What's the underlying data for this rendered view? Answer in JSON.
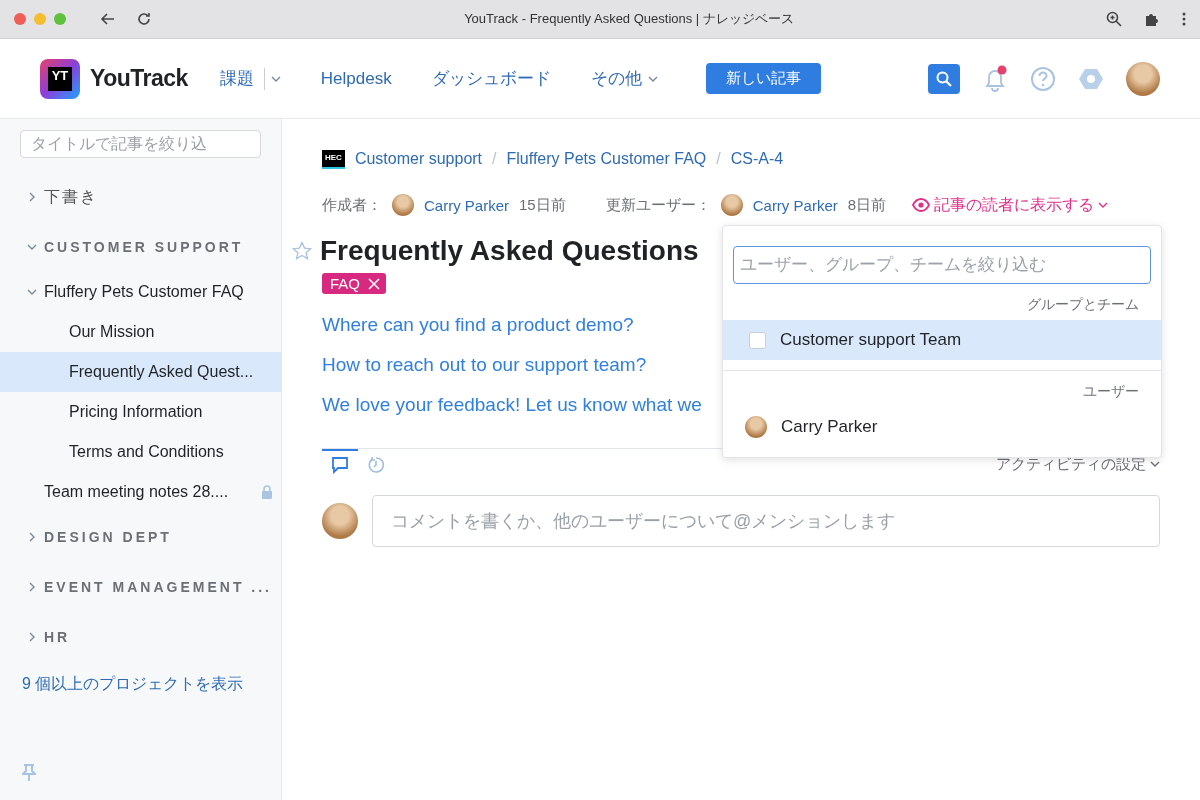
{
  "browser": {
    "title": "YouTrack - Frequently Asked Questions | ナレッジベース"
  },
  "header": {
    "logo_mark": "YT",
    "logo_text": "YouTrack",
    "nav": [
      {
        "label": "課題",
        "kind": "split"
      },
      {
        "label": "Helpdesk",
        "kind": "link"
      },
      {
        "label": "ダッシュボード",
        "kind": "link"
      },
      {
        "label": "その他",
        "kind": "dropdown"
      }
    ],
    "new_button": "新しい記事",
    "has_unread_notifications": true
  },
  "sidebar": {
    "filter_placeholder": "タイトルで記事を絞り込",
    "tree": [
      {
        "label": "下書き",
        "kind": "folder",
        "expanded": false,
        "selected": false
      },
      {
        "label": "CUSTOMER SUPPORT",
        "kind": "project",
        "expanded": true,
        "selected": false,
        "children": [
          {
            "label": "Fluffery Pets Customer FAQ",
            "kind": "article",
            "expanded": true,
            "selected": false,
            "locked": false,
            "children": [
              {
                "label": "Our Mission",
                "kind": "article",
                "selected": false,
                "locked": false
              },
              {
                "label": "Frequently Asked Quest...",
                "kind": "article",
                "selected": true,
                "locked": false
              },
              {
                "label": "Pricing Information",
                "kind": "article",
                "selected": false,
                "locked": false
              },
              {
                "label": "Terms and Conditions",
                "kind": "article",
                "selected": false,
                "locked": false
              }
            ]
          },
          {
            "label": "Team meeting notes 28....",
            "kind": "article",
            "selected": false,
            "locked": true
          }
        ]
      },
      {
        "label": "DESIGN DEPT",
        "kind": "project",
        "expanded": false,
        "selected": false
      },
      {
        "label": "EVENT MANAGEMENT ...",
        "kind": "project",
        "expanded": false,
        "selected": false
      },
      {
        "label": "HR",
        "kind": "project",
        "expanded": false,
        "selected": false
      }
    ],
    "more_link": "9 個以上のプロジェクトを表示"
  },
  "breadcrumb": {
    "project_badge": "HEC",
    "separator": "/",
    "items": [
      "Customer support",
      "Fluffery Pets Customer FAQ",
      "CS-A-4"
    ]
  },
  "meta": {
    "created_label": "作成者：",
    "created_by": "Carry Parker",
    "created_ago": "15日前",
    "updated_label": "更新ユーザー：",
    "updated_by": "Carry Parker",
    "updated_ago": "8日前",
    "visibility": "記事の読者に表示する"
  },
  "article": {
    "title": "Frequently Asked Questions",
    "starred": false,
    "tags": [
      "FAQ"
    ],
    "links": [
      "Where can you find a product demo?",
      "How to reach out to our support team?",
      "We love your feedback! Let us know what we"
    ]
  },
  "visibility_dropdown": {
    "placeholder": "ユーザー、グループ、チームを絞り込む",
    "sections": [
      {
        "heading": "グループとチーム",
        "items": [
          {
            "label": "Customer support Team",
            "kind": "group",
            "checked": false,
            "selected": true
          }
        ]
      },
      {
        "heading": "ユーザー",
        "items": [
          {
            "label": "Carry Parker",
            "kind": "user",
            "selected": false
          }
        ]
      }
    ]
  },
  "activity": {
    "tabs": [
      {
        "kind": "comments",
        "selected": true
      },
      {
        "kind": "history",
        "selected": false
      }
    ],
    "settings": "アクティビティの設定",
    "comment_placeholder": "コメントを書くか、他のユーザーについて@メンションします"
  }
}
